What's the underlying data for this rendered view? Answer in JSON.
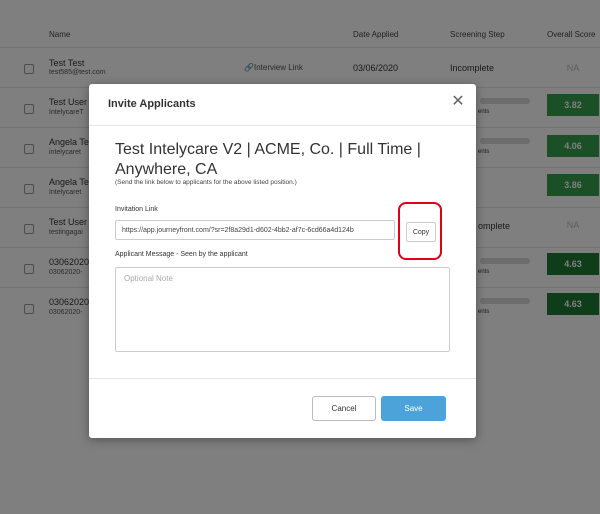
{
  "table": {
    "headers": [
      "Name",
      "Date Applied",
      "Screening Step",
      "Overall Score"
    ],
    "rows": [
      {
        "name": "Test Test",
        "email": "test585@test.com",
        "interview_link": "Interview Link",
        "date": "03/06/2020",
        "step": "Incomplete",
        "score": "NA"
      },
      {
        "name": "Test User -",
        "email": "IntelycareT",
        "step": "ents",
        "score": "3.82"
      },
      {
        "name": "Angela Tes",
        "email": "intelycaret",
        "step": "ents",
        "score": "4.06"
      },
      {
        "name": "Angela Tes",
        "email": "Intelycaret",
        "score": "3.86"
      },
      {
        "name": "Test User",
        "email": "testingagai",
        "step": "omplete",
        "score": "NA"
      },
      {
        "name": "03062020-",
        "email": "03062020-",
        "step": "ents",
        "score": "4.63"
      },
      {
        "name": "03062020-",
        "email": "03062020-",
        "step": "ents",
        "score": "4.63"
      }
    ]
  },
  "modal": {
    "title": "Invite Applicants",
    "job_title": "Test Intelycare V2 | ACME, Co. | Full Time | Anywhere, CA",
    "instructions": "(Send the link below to applicants for the above listed position.)",
    "link_label": "Invitation Link",
    "link_value": "https://app.journeyfront.com/?sr=2f8a29d1-d602-4bb2-af7c-6cd66a4d124b",
    "copy_label": "Copy",
    "message_label": "Applicant Message - Seen by the applicant",
    "message_placeholder": "Optional Note",
    "cancel_label": "Cancel",
    "save_label": "Save"
  },
  "icons": {
    "close": "close-icon",
    "link": "link-icon"
  },
  "colors": {
    "accent": "#4ba3d9",
    "score_mid": "#36a14e",
    "score_dark": "#1f7a34",
    "highlight": "#e0001b"
  }
}
